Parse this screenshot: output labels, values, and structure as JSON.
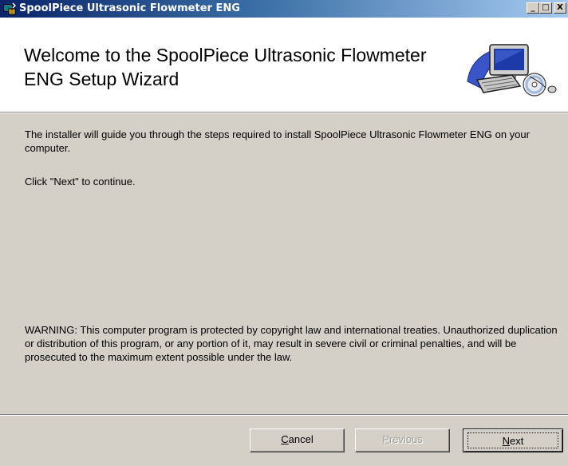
{
  "window": {
    "title": "SpoolPiece Ultrasonic Flowmeter ENG",
    "controls": {
      "minimize": "_",
      "maximize": "□",
      "close": "X"
    }
  },
  "banner": {
    "title": "Welcome to the SpoolPiece Ultrasonic Flowmeter ENG Setup Wizard",
    "icon": "computer-setup-icon"
  },
  "content": {
    "intro": "The installer will guide you through the steps required to install SpoolPiece Ultrasonic Flowmeter ENG on your computer.",
    "click_next": "Click \"Next\" to continue.",
    "warning": "WARNING: This computer program is protected by copyright law and international treaties. Unauthorized duplication or distribution of this program, or any portion of it, may result in severe civil or criminal penalties, and will be prosecuted to the maximum extent possible under the law."
  },
  "buttons": {
    "cancel": {
      "accesskey": "C",
      "rest": "ancel"
    },
    "previous": {
      "accesskey": "P",
      "rest": "revious",
      "enabled": false
    },
    "next": {
      "accesskey": "N",
      "rest": "ext",
      "default": true
    }
  },
  "colors": {
    "titlebar_start": "#0a246a",
    "titlebar_end": "#a6caf0",
    "face": "#d4d0c8"
  }
}
